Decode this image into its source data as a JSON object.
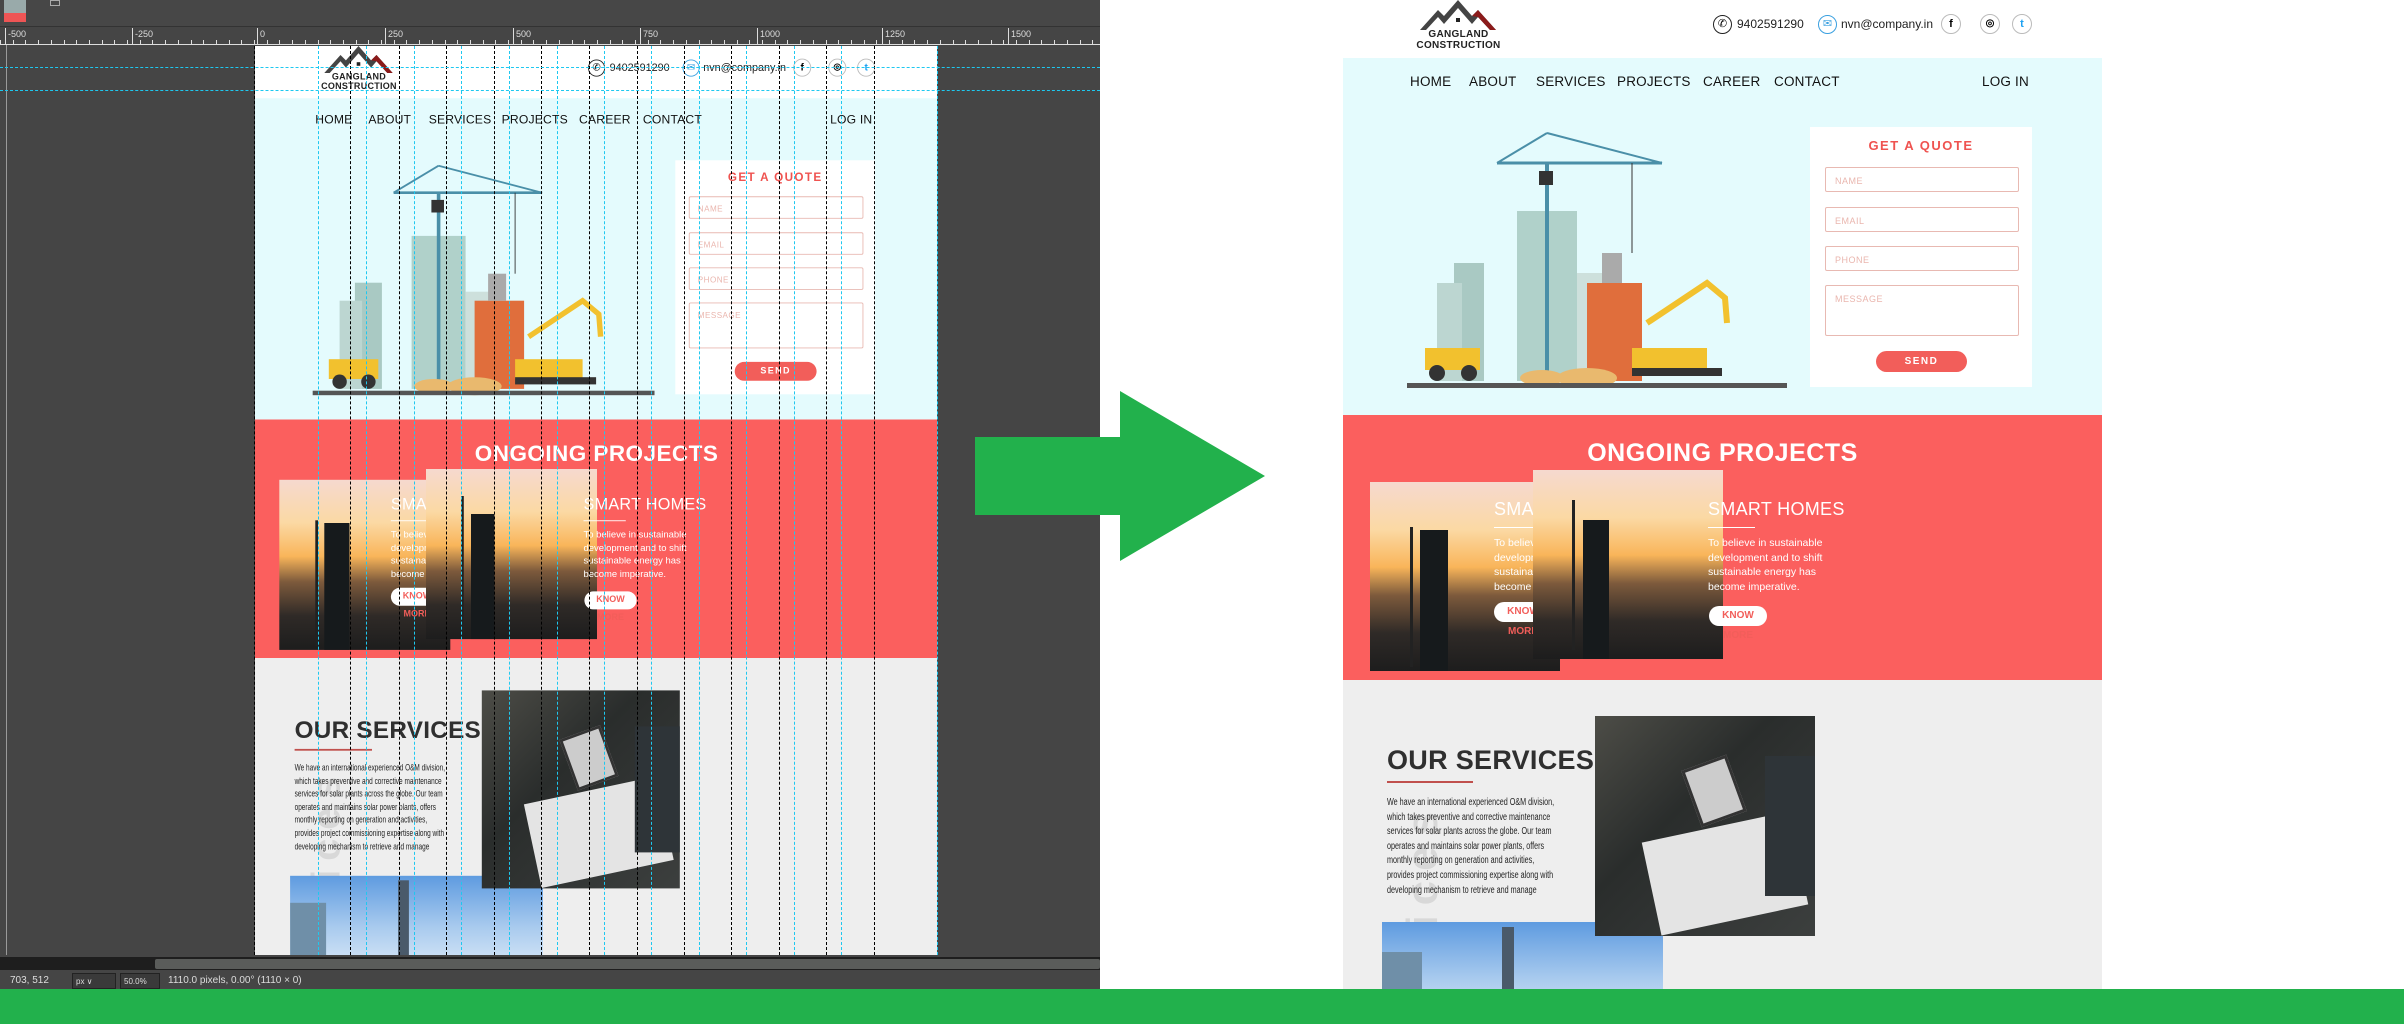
{
  "editor": {
    "ruler_labels": [
      "-500",
      "-250",
      "0",
      "250",
      "500",
      "750",
      "1000",
      "1250",
      "1500"
    ],
    "status": {
      "coords": "703, 512",
      "zoom": "50.0%",
      "unit": "px",
      "measure": "1110.0 pixels, 0.00° (1110 × 0)"
    }
  },
  "site": {
    "logo": {
      "line1": "GANGLAND",
      "line2": "CONSTRUCTION"
    },
    "contact": {
      "phone": "9402591290",
      "email": "nvn@company.in",
      "phone_icon": "phone-icon",
      "email_icon": "mail-icon"
    },
    "social": [
      {
        "icon": "facebook-icon",
        "glyph": "f"
      },
      {
        "icon": "instagram-icon",
        "glyph": "◎"
      },
      {
        "icon": "twitter-icon",
        "glyph": "t"
      }
    ],
    "nav": [
      "HOME",
      "ABOUT",
      "SERVICES",
      "PROJECTS",
      "CAREER",
      "CONTACT"
    ],
    "login": "LOG IN",
    "quote": {
      "title": "GET A QUOTE",
      "name": "NAME",
      "email": "EMAIL",
      "phone": "PHONE",
      "message": "MESSAGE",
      "send": "SEND"
    },
    "projects": {
      "title": "ONGOING PROJECTS",
      "cards": [
        {
          "title": "SMART HOMES",
          "lines": [
            "To believe in sustainable",
            "development and to shift",
            "sustainable energy has",
            "become imperative."
          ],
          "button": "KNOW MORE"
        },
        {
          "title": "SMART HOMES",
          "lines": [
            "To believe in sustainable",
            "development and to shift",
            "sustainable energy has",
            "become imperative."
          ],
          "button": "KNOW MORE"
        }
      ]
    },
    "services": {
      "title": "OUR SERVICES",
      "lines": [
        "We have an international experienced O&M division,",
        "which takes preventive and corrective maintenance",
        "services for solar plants across the globe. Our team",
        "operates and maintains solar power plants, offers",
        "monthly reporting on generation and activities,",
        "provides project commissioning expertise along with",
        "developing mechanism to retrieve and manage"
      ],
      "watermark": "services"
    }
  },
  "colors": {
    "accent": "#fb5f5e",
    "hero_bg": "#e4fbfd",
    "services_bg": "#eeeeee",
    "arrow": "#22b14c",
    "editor_bg": "#454545"
  }
}
